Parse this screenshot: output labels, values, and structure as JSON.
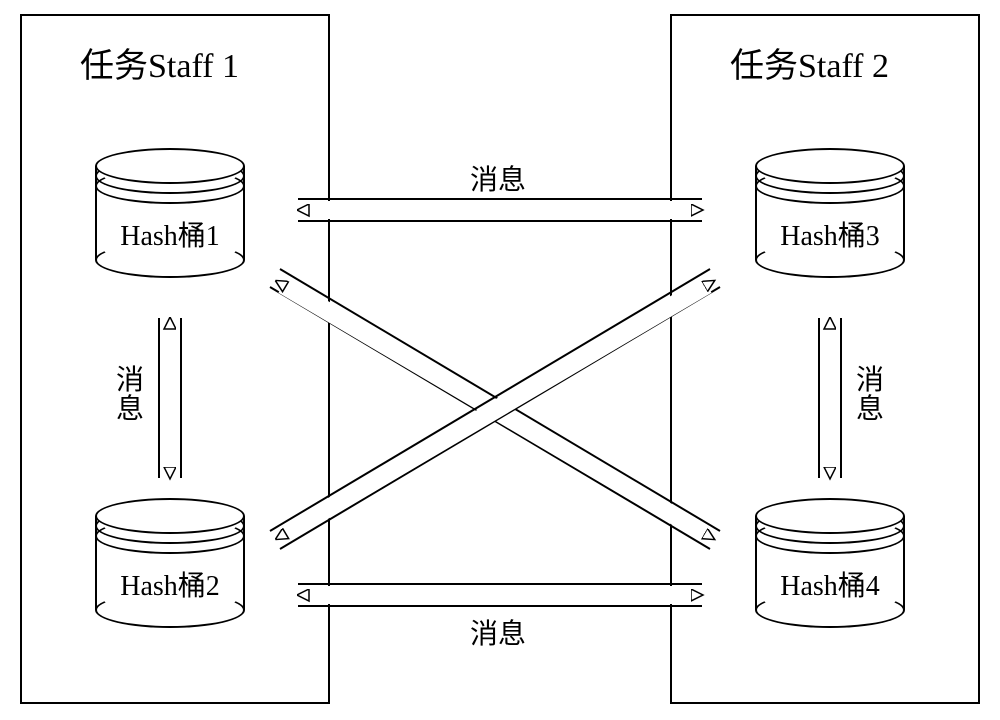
{
  "staff": {
    "left_title": "任务Staff 1",
    "right_title": "任务Staff 2"
  },
  "buckets": {
    "b1": "Hash桶1",
    "b2": "Hash桶2",
    "b3": "Hash桶3",
    "b4": "Hash桶4"
  },
  "labels": {
    "msg": "消息"
  }
}
